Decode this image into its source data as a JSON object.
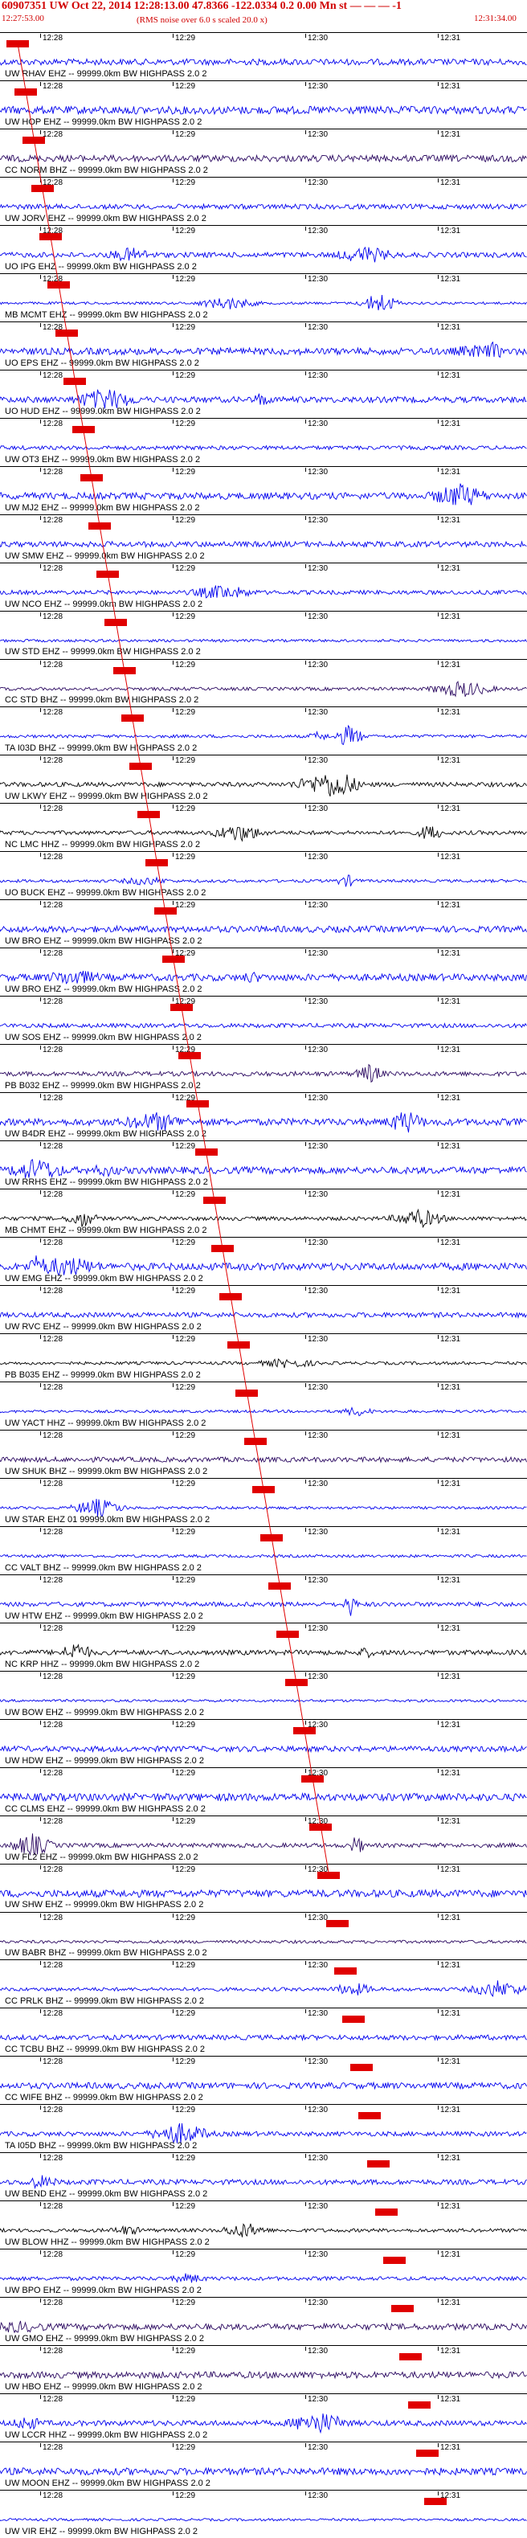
{
  "header": {
    "title_line": "60907351 UW Oct 22, 2014 12:28:13.00   47.8366 -122.0334  0.2 0.00 Mn st  — — —  -1",
    "start_time": "12:27:53.00",
    "note": "(RMS noise over 6.0 s scaled 20.0 x)",
    "end_time": "12:31:34.00"
  },
  "time_ticks": [
    "12:28",
    "12:29",
    "12:30",
    "12:31"
  ],
  "colors": {
    "red": "#e00000",
    "blue": "#0000ee",
    "purple": "#2a0860",
    "black": "#000000"
  },
  "traces": [
    {
      "label": "UW RHAV EHZ -- 99999.0km BW  HIGHPASS  2.0  2",
      "color": "blue"
    },
    {
      "label": "UW HOP EHZ -- 99999.0km BW  HIGHPASS  2.0  2",
      "color": "blue"
    },
    {
      "label": "CC NORM BHZ -- 99999.0km BW  HIGHPASS  2.0  2",
      "color": "purple"
    },
    {
      "label": "UW JORV EHZ -- 99999.0km BW  HIGHPASS  2.0  2",
      "color": "blue"
    },
    {
      "label": "UO IPG EHZ -- 99999.0km BW  HIGHPASS  2.0  2",
      "color": "blue"
    },
    {
      "label": "MB MCMT EHZ -- 99999.0km BW  HIGHPASS  2.0  2",
      "color": "blue"
    },
    {
      "label": "UO EPS EHZ -- 99999.0km BW  HIGHPASS  2.0  2",
      "color": "blue"
    },
    {
      "label": "UO HUD EHZ -- 99999.0km BW  HIGHPASS  2.0  2",
      "color": "blue"
    },
    {
      "label": "UW OT3 EHZ -- 99999.0km BW  HIGHPASS  2.0  2",
      "color": "blue"
    },
    {
      "label": "UW MJ2 EHZ -- 99999.0km BW  HIGHPASS  2.0  2",
      "color": "blue"
    },
    {
      "label": "UW SMW EHZ -- 99999.0km BW  HIGHPASS  2.0  2",
      "color": "blue"
    },
    {
      "label": "UW NCO EHZ -- 99999.0km BW  HIGHPASS  2.0  2",
      "color": "blue"
    },
    {
      "label": "UW STD EHZ -- 99999.0km BW  HIGHPASS  2.0  2",
      "color": "blue"
    },
    {
      "label": "CC STD BHZ -- 99999.0km BW  HIGHPASS  2.0  2",
      "color": "purple"
    },
    {
      "label": "TA I03D BHZ -- 99999.0km BW  HIGHPASS  2.0  2",
      "color": "blue"
    },
    {
      "label": "UW LKWY EHZ -- 99999.0km BW  HIGHPASS  2.0  2",
      "color": "black"
    },
    {
      "label": "NC LMC HHZ -- 99999.0km BW  HIGHPASS  2.0  2",
      "color": "black"
    },
    {
      "label": "UO BUCK EHZ -- 99999.0km BW  HIGHPASS  2.0  2",
      "color": "blue"
    },
    {
      "label": "UW BRO EHZ -- 99999.0km BW  HIGHPASS  2.0  2",
      "color": "blue"
    },
    {
      "label": "UW BRO EHZ -- 99999.0km BW  HIGHPASS  2.0  2",
      "color": "blue"
    },
    {
      "label": "UW SOS EHZ -- 99999.0km BW  HIGHPASS  2.0  2",
      "color": "blue"
    },
    {
      "label": "PB B032 EHZ -- 99999.0km BW  HIGHPASS  2.0  2",
      "color": "purple"
    },
    {
      "label": "UW B4DR EHZ -- 99999.0km BW  HIGHPASS  2.0  2",
      "color": "blue"
    },
    {
      "label": "UW RRHS EHZ -- 99999.0km BW  HIGHPASS  2.0  2",
      "color": "blue"
    },
    {
      "label": "MB CHMT EHZ -- 99999.0km BW  HIGHPASS  2.0  2",
      "color": "black"
    },
    {
      "label": "UW EMG EHZ -- 99999.0km BW  HIGHPASS  2.0  2",
      "color": "blue"
    },
    {
      "label": "UW RVC EHZ -- 99999.0km BW  HIGHPASS  2.0  2",
      "color": "blue"
    },
    {
      "label": "PB B035 EHZ -- 99999.0km BW  HIGHPASS  2.0  2",
      "color": "black"
    },
    {
      "label": "UW YACT HHZ -- 99999.0km BW  HIGHPASS  2.0  2",
      "color": "blue"
    },
    {
      "label": "UW SHUK BHZ -- 99999.0km BW  HIGHPASS  2.0  2",
      "color": "purple"
    },
    {
      "label": "UW STAR EHZ 01 99999.0km BW HIGHPASS  2.0  2",
      "color": "blue"
    },
    {
      "label": "CC VALT BHZ -- 99999.0km BW  HIGHPASS  2.0  2",
      "color": "blue"
    },
    {
      "label": "UW HTW EHZ -- 99999.0km BW  HIGHPASS  2.0  2",
      "color": "blue"
    },
    {
      "label": "NC KRP HHZ -- 99999.0km BW  HIGHPASS  2.0  2",
      "color": "black"
    },
    {
      "label": "UW BOW EHZ -- 99999.0km BW  HIGHPASS  2.0  2",
      "color": "blue"
    },
    {
      "label": "UW HDW EHZ -- 99999.0km BW  HIGHPASS  2.0  2",
      "color": "blue"
    },
    {
      "label": "CC CLMS EHZ -- 99999.0km BW  HIGHPASS  2.0  2",
      "color": "blue"
    },
    {
      "label": "UW FL2 EHZ -- 99999.0km BW  HIGHPASS  2.0  2",
      "color": "purple"
    },
    {
      "label": "UW SHW EHZ -- 99999.0km BW  HIGHPASS  2.0  2",
      "color": "blue"
    },
    {
      "label": "UW BABR BHZ -- 99999.0km BW  HIGHPASS  2.0  2",
      "color": "purple"
    },
    {
      "label": "CC PRLK BHZ -- 99999.0km BW  HIGHPASS  2.0  2",
      "color": "blue"
    },
    {
      "label": "CC TCBU BHZ -- 99999.0km BW  HIGHPASS  2.0  2",
      "color": "blue"
    },
    {
      "label": "CC WIFE BHZ -- 99999.0km BW  HIGHPASS  2.0  2",
      "color": "blue"
    },
    {
      "label": "TA I05D BHZ -- 99999.0km BW  HIGHPASS  2.0  2",
      "color": "blue"
    },
    {
      "label": "UW BEND EHZ -- 99999.0km BW  HIGHPASS  2.0  2",
      "color": "blue"
    },
    {
      "label": "UW BLOW HHZ -- 99999.0km BW  HIGHPASS  2.0  2",
      "color": "black"
    },
    {
      "label": "UW BPO EHZ -- 99999.0km BW  HIGHPASS  2.0  2",
      "color": "blue"
    },
    {
      "label": "UW GMO EHZ -- 99999.0km BW  HIGHPASS  2.0  2",
      "color": "purple"
    },
    {
      "label": "UW HBO EHZ -- 99999.0km BW  HIGHPASS  2.0  2",
      "color": "purple"
    },
    {
      "label": "UW LCCR HHZ -- 99999.0km BW  HIGHPASS  2.0  2",
      "color": "blue"
    },
    {
      "label": "UW MOON EHZ -- 99999.0km BW  HIGHPASS  2.0  2",
      "color": "blue"
    },
    {
      "label": "UW VIR EHZ -- 99999.0km BW  HIGHPASS  2.0  2",
      "color": "blue"
    }
  ]
}
